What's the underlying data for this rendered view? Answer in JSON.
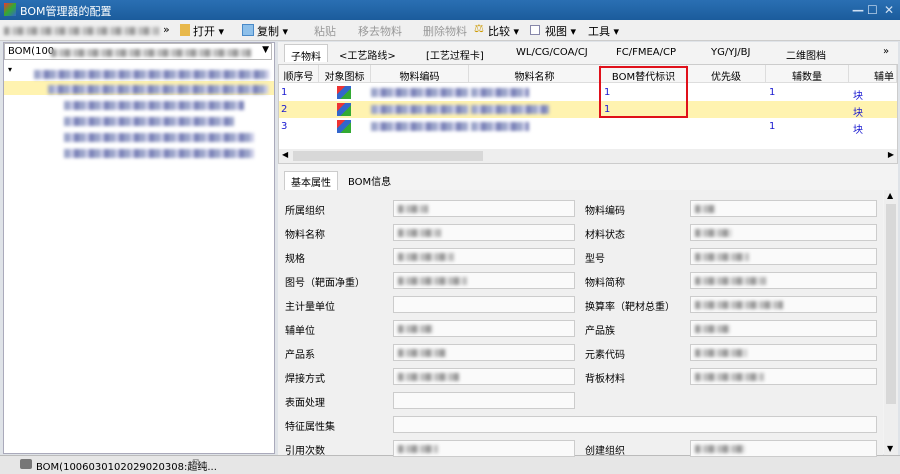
{
  "window": {
    "title": "BOM管理器的配置"
  },
  "toolbar": {
    "open": "打开 ▾",
    "copy": "复制 ▾",
    "paste": "粘贴",
    "remove": "移去物料",
    "delete": "删除物料",
    "compare": "比较 ▾",
    "view": "视图 ▾",
    "tools": "工具 ▾"
  },
  "left": {
    "combo_value": "BOM(100"
  },
  "tabs": [
    "子物料",
    "<工艺路线>",
    "[工艺过程卡]",
    "WL/CG/COA/CJ",
    "FC/FMEA/CP",
    "YG/YJ/BJ",
    "二维图档"
  ],
  "grid": {
    "headers": [
      "顺序号",
      "对象图标",
      "物料编码",
      "物料名称",
      "BOM替代标识",
      "优先级",
      "辅数量",
      "辅单"
    ],
    "rows": [
      {
        "seq": "1",
        "bom_alt": "1",
        "aux_qty": "1",
        "aux_unit": "块"
      },
      {
        "seq": "2",
        "bom_alt": "1",
        "aux_qty": "",
        "aux_unit": "块"
      },
      {
        "seq": "3",
        "bom_alt": "",
        "aux_qty": "1",
        "aux_unit": "块"
      }
    ]
  },
  "subtabs": [
    "基本属性",
    "BOM信息"
  ],
  "form": {
    "left_labels": [
      "所属组织",
      "物料名称",
      "规格",
      "图号（靶面净重）",
      "主计量单位",
      "辅单位",
      "产品系",
      "焊接方式",
      "表面处理",
      "特征属性集",
      "引用次数"
    ],
    "right_labels": [
      "物料编码",
      "材料状态",
      "型号",
      "物料简称",
      "换算率（靶材总重）",
      "产品族",
      "元素代码",
      "背板材料",
      "",
      "",
      "创建组织"
    ]
  },
  "bottom_tab": {
    "label": "BOM(1006030102029020308:超纯...",
    "close": "⊠"
  }
}
